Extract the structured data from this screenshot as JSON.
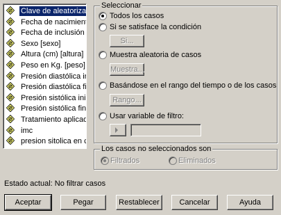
{
  "variables": [
    {
      "label": "Clave de aleatorización"
    },
    {
      "label": "Fecha de nacimiento [f"
    },
    {
      "label": "Fecha de inclusión [f_i"
    },
    {
      "label": "Sexo [sexo]"
    },
    {
      "label": "Altura (cm) [altura]"
    },
    {
      "label": "Peso en Kg. [peso]"
    },
    {
      "label": "Presión diastólica inicial"
    },
    {
      "label": "Presión diastólica final"
    },
    {
      "label": "Presión sistólica inicial"
    },
    {
      "label": "Presión sistólica final [p"
    },
    {
      "label": "Tratamiento aplicado [t"
    },
    {
      "label": "imc"
    },
    {
      "label": "presion sitolica en cate"
    }
  ],
  "select": {
    "title": "Seleccionar",
    "all_cases": "Todos los casos",
    "if_condition": "Si se satisface la condición",
    "if_button": "Si...",
    "random_sample": "Muestra aleatoria de casos",
    "sample_button": "Muestra...",
    "range": "Basándose en el rango del tiempo o de los casos",
    "range_button": "Rango...",
    "filter_variable": "Usar variable de filtro:",
    "filter_value": ""
  },
  "unselected": {
    "title": "Los casos no seleccionados son",
    "filtered": "Filtrados",
    "deleted": "Eliminados"
  },
  "status": "Estado actual: No filtrar casos",
  "buttons": {
    "ok": "Aceptar",
    "paste": "Pegar",
    "reset": "Restablecer",
    "cancel": "Cancelar",
    "help": "Ayuda"
  },
  "colors": {
    "dialog_bg": "#d4d0c8",
    "selection": "#0a246a",
    "variable_icon": "#ffff80"
  }
}
